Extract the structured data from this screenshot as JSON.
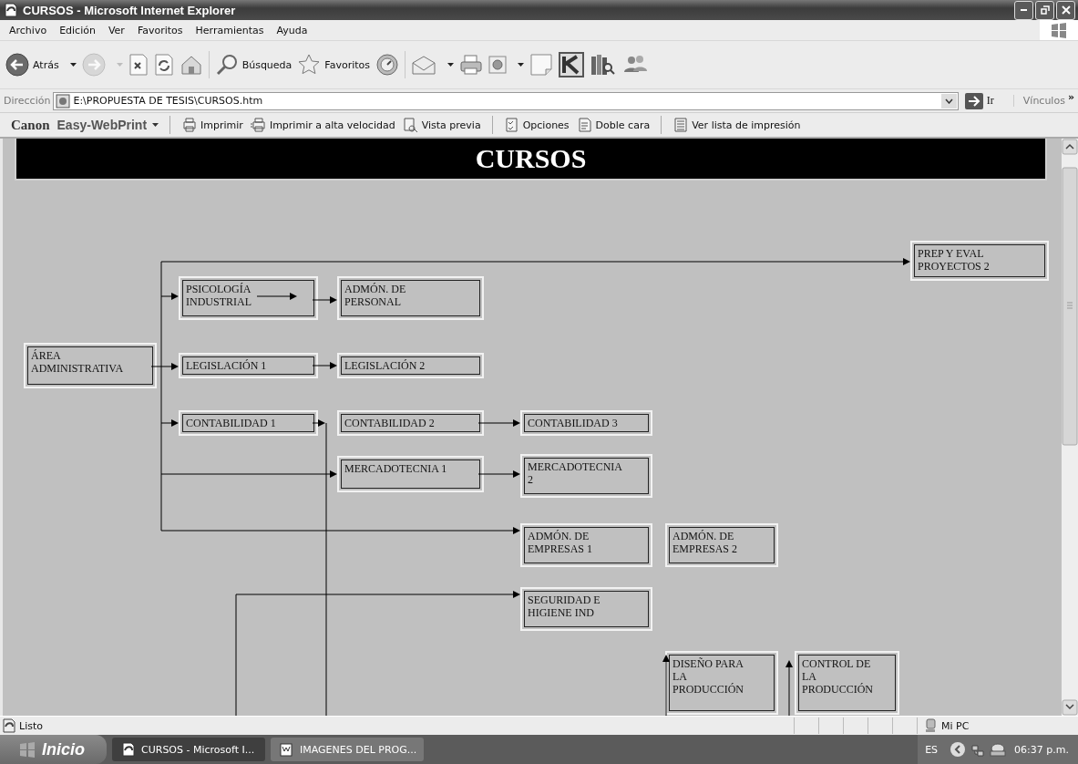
{
  "window": {
    "title": "CURSOS - Microsoft Internet Explorer"
  },
  "menu": [
    "Archivo",
    "Edición",
    "Ver",
    "Favoritos",
    "Herramientas",
    "Ayuda"
  ],
  "toolbar": [
    {
      "kind": "back",
      "label": "Atrás",
      "dropdown": true,
      "disabled": false
    },
    {
      "kind": "forward",
      "dropdown": true,
      "disabled": true
    },
    {
      "kind": "stop",
      "dropdown": false,
      "disabled": false
    },
    {
      "kind": "refresh",
      "dropdown": false,
      "disabled": false
    },
    {
      "kind": "home",
      "dropdown": false,
      "disabled": false
    },
    {
      "kind": "separator"
    },
    {
      "kind": "search",
      "label": "Búsqueda",
      "dropdown": false,
      "disabled": false
    },
    {
      "kind": "favorites",
      "label": "Favoritos",
      "dropdown": false,
      "disabled": false
    },
    {
      "kind": "history",
      "dropdown": false,
      "disabled": false
    },
    {
      "kind": "separator"
    },
    {
      "kind": "mail",
      "dropdown": true,
      "disabled": false
    },
    {
      "kind": "print",
      "dropdown": false,
      "disabled": false
    },
    {
      "kind": "edit",
      "dropdown": true,
      "disabled": false
    },
    {
      "kind": "note",
      "dropdown": false,
      "disabled": false
    },
    {
      "kind": "app",
      "dropdown": false,
      "disabled": false
    },
    {
      "kind": "research",
      "dropdown": false,
      "disabled": false
    },
    {
      "kind": "messenger",
      "dropdown": false,
      "disabled": false
    }
  ],
  "address": {
    "label": "Dirección",
    "value": "E:\\PROPUESTA DE TESIS\\CURSOS.htm",
    "go": "Ir",
    "links": "Vínculos",
    "more": "»"
  },
  "print_bar": {
    "brand": "Canon",
    "product": "Easy-WebPrint",
    "items": [
      {
        "kind": "separator"
      },
      {
        "kind": "print",
        "label": "Imprimir"
      },
      {
        "kind": "fastprint",
        "label": "Imprimir a alta velocidad"
      },
      {
        "kind": "preview",
        "label": "Vista previa"
      },
      {
        "kind": "separator"
      },
      {
        "kind": "options",
        "label": "Opciones"
      },
      {
        "kind": "duplex",
        "label": "Doble cara"
      },
      {
        "kind": "separator"
      },
      {
        "kind": "list",
        "label": "Ver lista de impresión"
      }
    ]
  },
  "page": {
    "heading": "CURSOS",
    "courses": [
      "ÁREA\nADMINISTRATIVA",
      "PSICOLOGÍA\nINDUSTRIAL",
      "ADMÓN. DE\nPERSONAL",
      "LEGISLACIÓN 1",
      "LEGISLACIÓN 2",
      "CONTABILIDAD 1",
      "CONTABILIDAD 2",
      "CONTABILIDAD 3",
      "MERCADOTECNIA 1",
      "MERCADOTECNIA\n2",
      "ADMÓN. DE\nEMPRESAS 1",
      "ADMÓN. DE\nEMPRESAS 2",
      "SEGURIDAD E\nHIGIENE IND",
      "DISEÑO PARA\nLA\nPRODUCCIÓN",
      "CONTROL DE\nLA\nPRODUCCIÓN",
      "PREP Y EVAL\nPROYECTOS 2"
    ]
  },
  "status_bar": {
    "text": "Listo",
    "zone": "Mi PC"
  },
  "taskbar": {
    "start": "Inicio",
    "tasks": [
      {
        "label": "CURSOS - Microsoft I...",
        "kind": "browser",
        "selected": true
      },
      {
        "label": "IMAGENES DEL PROG...",
        "kind": "document",
        "selected": false
      }
    ],
    "language": "ES",
    "clock": "06:37 p.m."
  }
}
